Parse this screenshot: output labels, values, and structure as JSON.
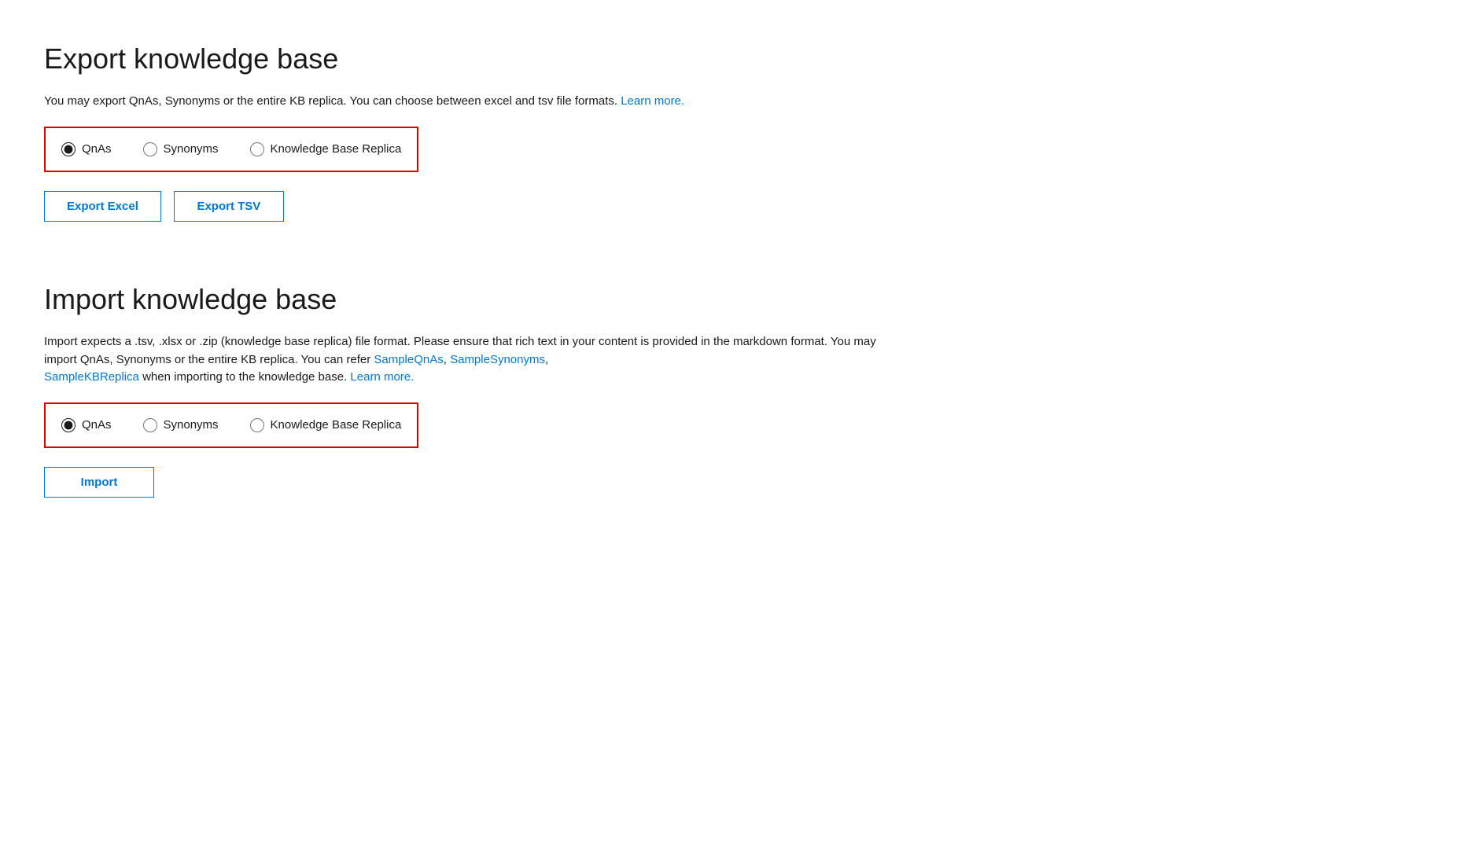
{
  "export_section": {
    "title": "Export knowledge base",
    "description": "You may export QnAs, Synonyms or the entire KB replica. You can choose between excel and tsv file formats.",
    "learn_more_link": "Learn more.",
    "radio_group": {
      "options": [
        {
          "id": "export-qnas",
          "label": "QnAs",
          "checked": true
        },
        {
          "id": "export-synonyms",
          "label": "Synonyms",
          "checked": false
        },
        {
          "id": "export-kb-replica",
          "label": "Knowledge Base Replica",
          "checked": false
        }
      ]
    },
    "buttons": [
      {
        "id": "export-excel-btn",
        "label": "Export Excel"
      },
      {
        "id": "export-tsv-btn",
        "label": "Export TSV"
      }
    ]
  },
  "import_section": {
    "title": "Import knowledge base",
    "description_part1": "Import expects a .tsv, .xlsx or .zip (knowledge base replica) file format. Please ensure that rich text in your content is provided in the markdown format. You may import QnAs, Synonyms or the entire KB replica. You can refer",
    "sample_qnas_link": "SampleQnAs",
    "sample_synonyms_link": "SampleSynonyms",
    "sample_kb_replica_link": "SampleKBReplica",
    "description_part2": "when importing to the knowledge base.",
    "learn_more_link": "Learn more.",
    "radio_group": {
      "options": [
        {
          "id": "import-qnas",
          "label": "QnAs",
          "checked": true
        },
        {
          "id": "import-synonyms",
          "label": "Synonyms",
          "checked": false
        },
        {
          "id": "import-kb-replica",
          "label": "Knowledge Base Replica",
          "checked": false
        }
      ]
    },
    "buttons": [
      {
        "id": "import-btn",
        "label": "Import"
      }
    ]
  }
}
